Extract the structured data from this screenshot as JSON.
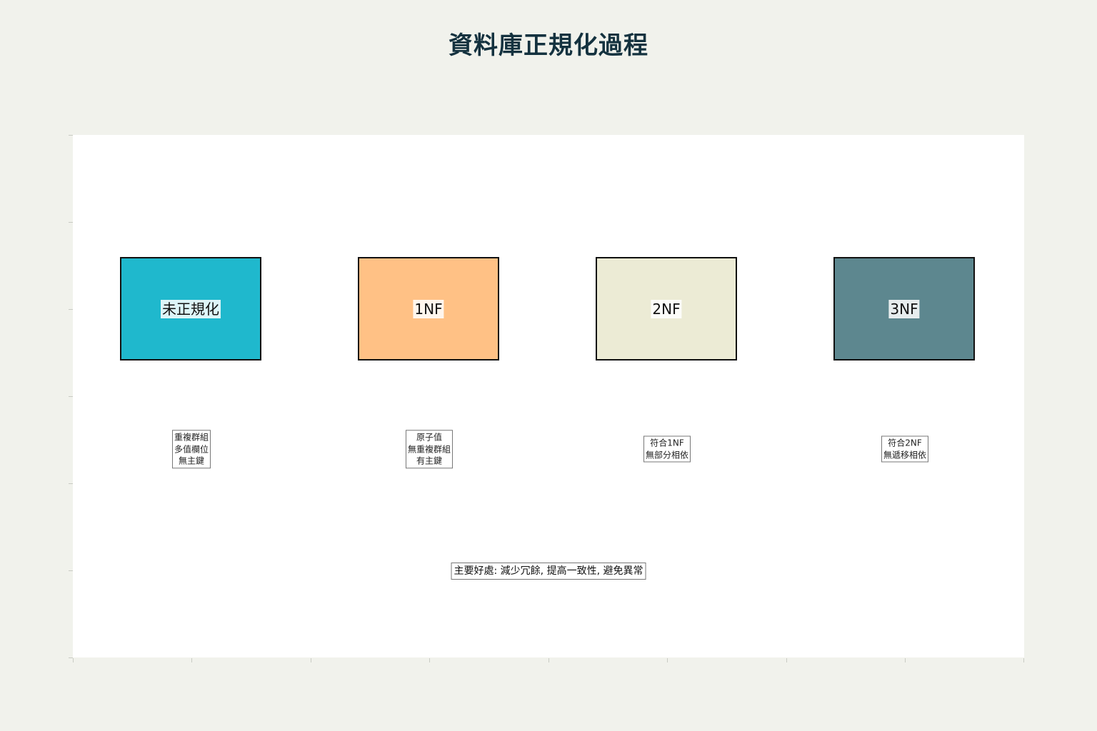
{
  "title": "資料庫正規化過程",
  "colors": {
    "background": "#f1f2ec",
    "plot_background": "#ffffff",
    "title": "#14323f",
    "stage_unnormalized": "#1fb8cd",
    "stage_1nf": "#ffc185",
    "stage_2nf": "#eceBd5",
    "stage_3nf": "#5d878f"
  },
  "stages": [
    {
      "label": "未正規化",
      "color": "#1fb8cd",
      "notes": [
        "重複群組",
        "多值欄位",
        "無主鍵"
      ]
    },
    {
      "label": "1NF",
      "color": "#ffc185",
      "notes": [
        "原子值",
        "無重複群組",
        "有主鍵"
      ]
    },
    {
      "label": "2NF",
      "color": "#ecebd5",
      "notes": [
        "符合1NF",
        "無部分相依"
      ]
    },
    {
      "label": "3NF",
      "color": "#5d878f",
      "notes": [
        "符合2NF",
        "無遞移相依"
      ]
    }
  ],
  "benefits": "主要好處: 減少冗餘, 提高一致性, 避免異常"
}
